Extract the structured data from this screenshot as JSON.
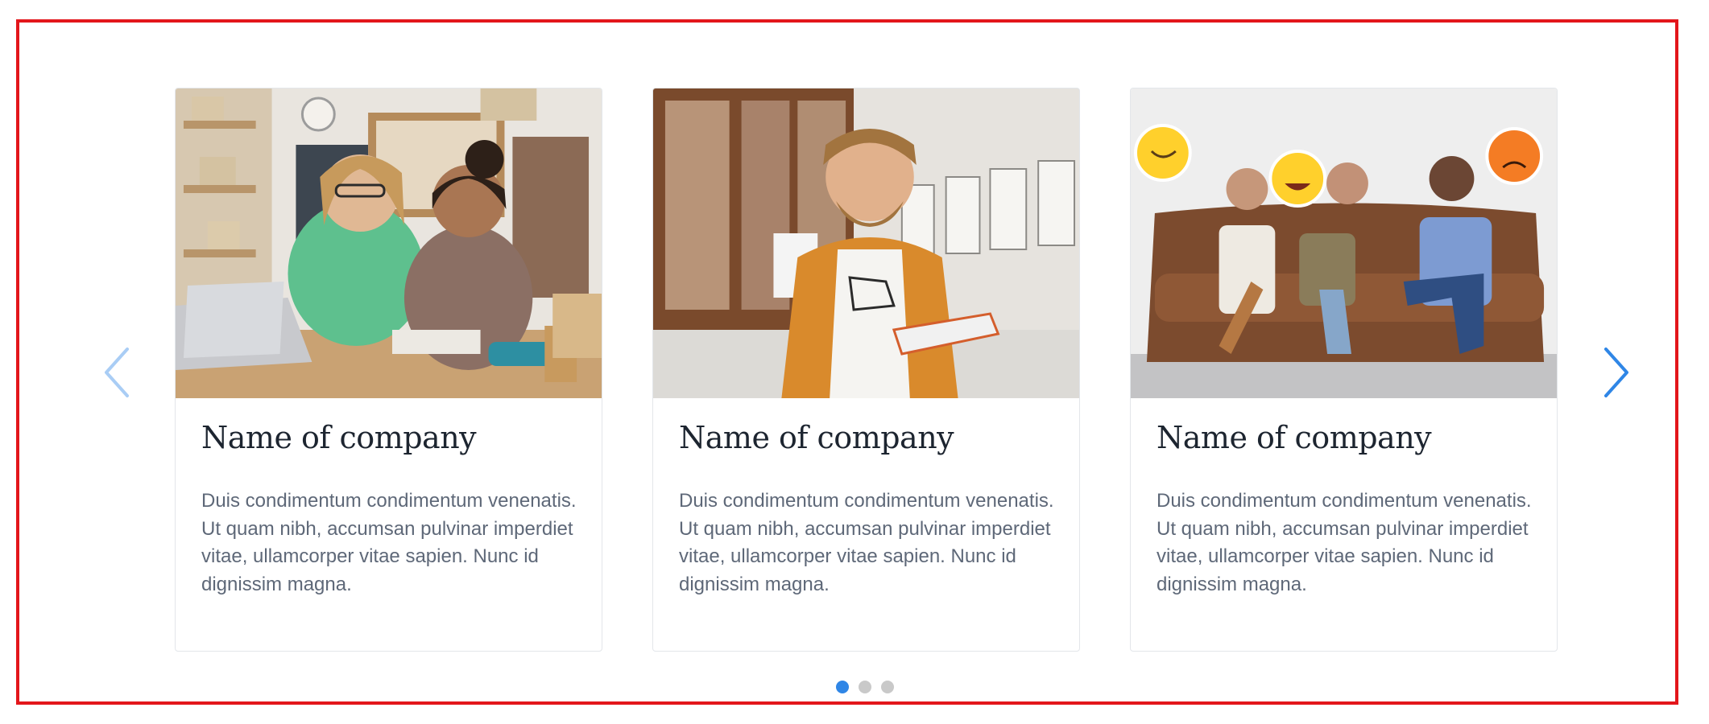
{
  "carousel": {
    "cards": [
      {
        "title": "Name of company",
        "text": "Duis condimentum condimentum venenatis. Ut quam nibh, accumsan pulvinar imperdiet vitae, ullamcorper vitae sapien. Nunc id dignissim magna.",
        "image": "two-women-working-photo"
      },
      {
        "title": "Name of company",
        "text": "Duis condimentum condimentum venenatis. Ut quam nibh, accumsan pulvinar imperdiet vitae, ullamcorper vitae sapien. Nunc id dignissim magna.",
        "image": "smiling-man-holding-glasses-photo"
      },
      {
        "title": "Name of company",
        "text": "Duis condimentum condimentum venenatis. Ut quam nibh, accumsan pulvinar imperdiet vitae, ullamcorper vitae sapien. Nunc id dignissim magna.",
        "image": "people-on-sofa-with-emojis-photo"
      }
    ],
    "prev_icon": "chevron-left-icon",
    "next_icon": "chevron-right-icon",
    "pagination": {
      "count": 3,
      "active_index": 0
    }
  },
  "colors": {
    "frame_border": "#e3161b",
    "accent": "#2f86e6",
    "prev_arrow_disabled": "#a9cdf5",
    "dot_inactive": "#c9c9c9",
    "title_text": "#1d2530",
    "body_text": "#5e6878"
  }
}
